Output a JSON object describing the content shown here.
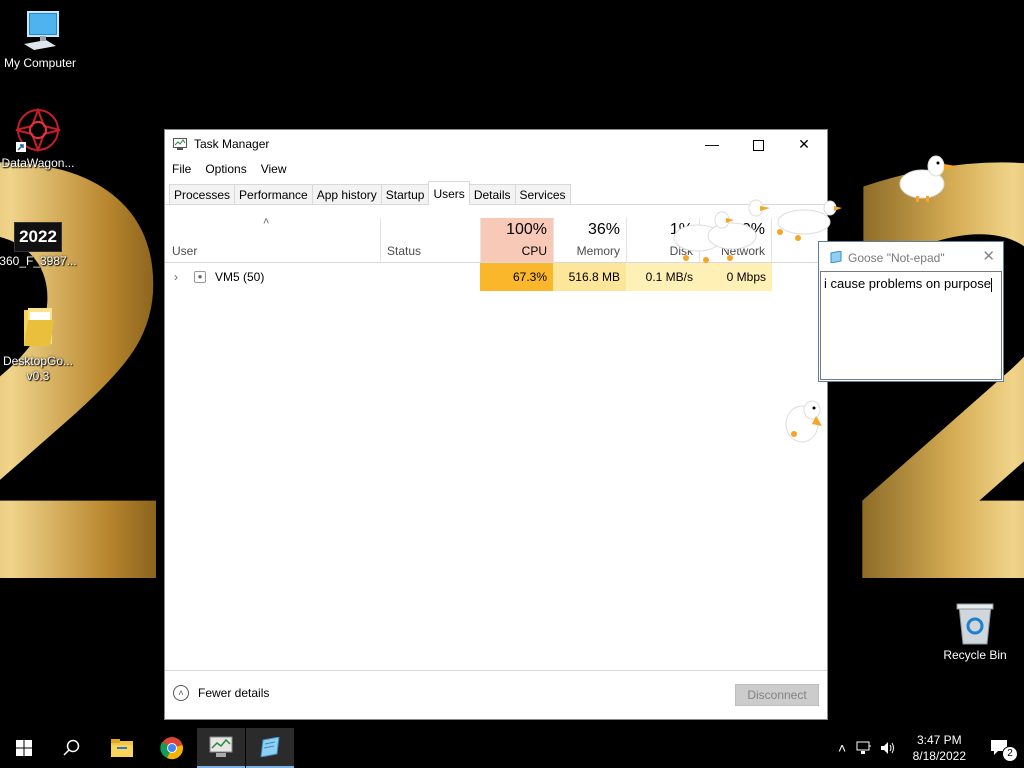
{
  "desktop": {
    "icons": [
      {
        "label": "My Computer"
      },
      {
        "label": "DataWagon..."
      },
      {
        "label": "360_F_3987..."
      },
      {
        "label": "DesktopGo...",
        "label2": "v0.3"
      },
      {
        "label": "Recycle Bin"
      }
    ],
    "wallpaper_digits": [
      "2",
      "2",
      "2"
    ],
    "thumbnail_text": "2022"
  },
  "task_manager": {
    "title": "Task Manager",
    "menu": [
      "File",
      "Options",
      "View"
    ],
    "tabs": [
      "Processes",
      "Performance",
      "App history",
      "Startup",
      "Users",
      "Details",
      "Services"
    ],
    "active_tab": "Users",
    "columns": {
      "user": "User",
      "status": "Status",
      "cpu": {
        "pct": "100%",
        "label": "CPU"
      },
      "memory": {
        "pct": "36%",
        "label": "Memory"
      },
      "disk": {
        "pct": "1%",
        "label": "Disk"
      },
      "network": {
        "pct": "0%",
        "label": "Network"
      }
    },
    "rows": [
      {
        "user": "VM5 (50)",
        "status": "",
        "cpu": "67.3%",
        "memory": "516.8 MB",
        "disk": "0.1 MB/s",
        "network": "0 Mbps"
      }
    ],
    "footer": {
      "fewer_details": "Fewer details",
      "disconnect": "Disconnect"
    }
  },
  "notepad": {
    "title": "Goose \"Not-epad\"",
    "text": "i cause problems on purpose"
  },
  "taskbar": {
    "apps": [
      "windows-start",
      "search",
      "file-explorer",
      "chrome",
      "task-manager",
      "notepad"
    ],
    "time": "3:47 PM",
    "date": "8/18/2022",
    "notification_count": "2"
  },
  "colors": {
    "cpu_header": "#f9c9b8",
    "cpu_cell": "#fbb72c",
    "heat_cell": "#fff1b6",
    "memory_cell": "#fde59a",
    "taskbar_accent": "#7fb3e6"
  }
}
